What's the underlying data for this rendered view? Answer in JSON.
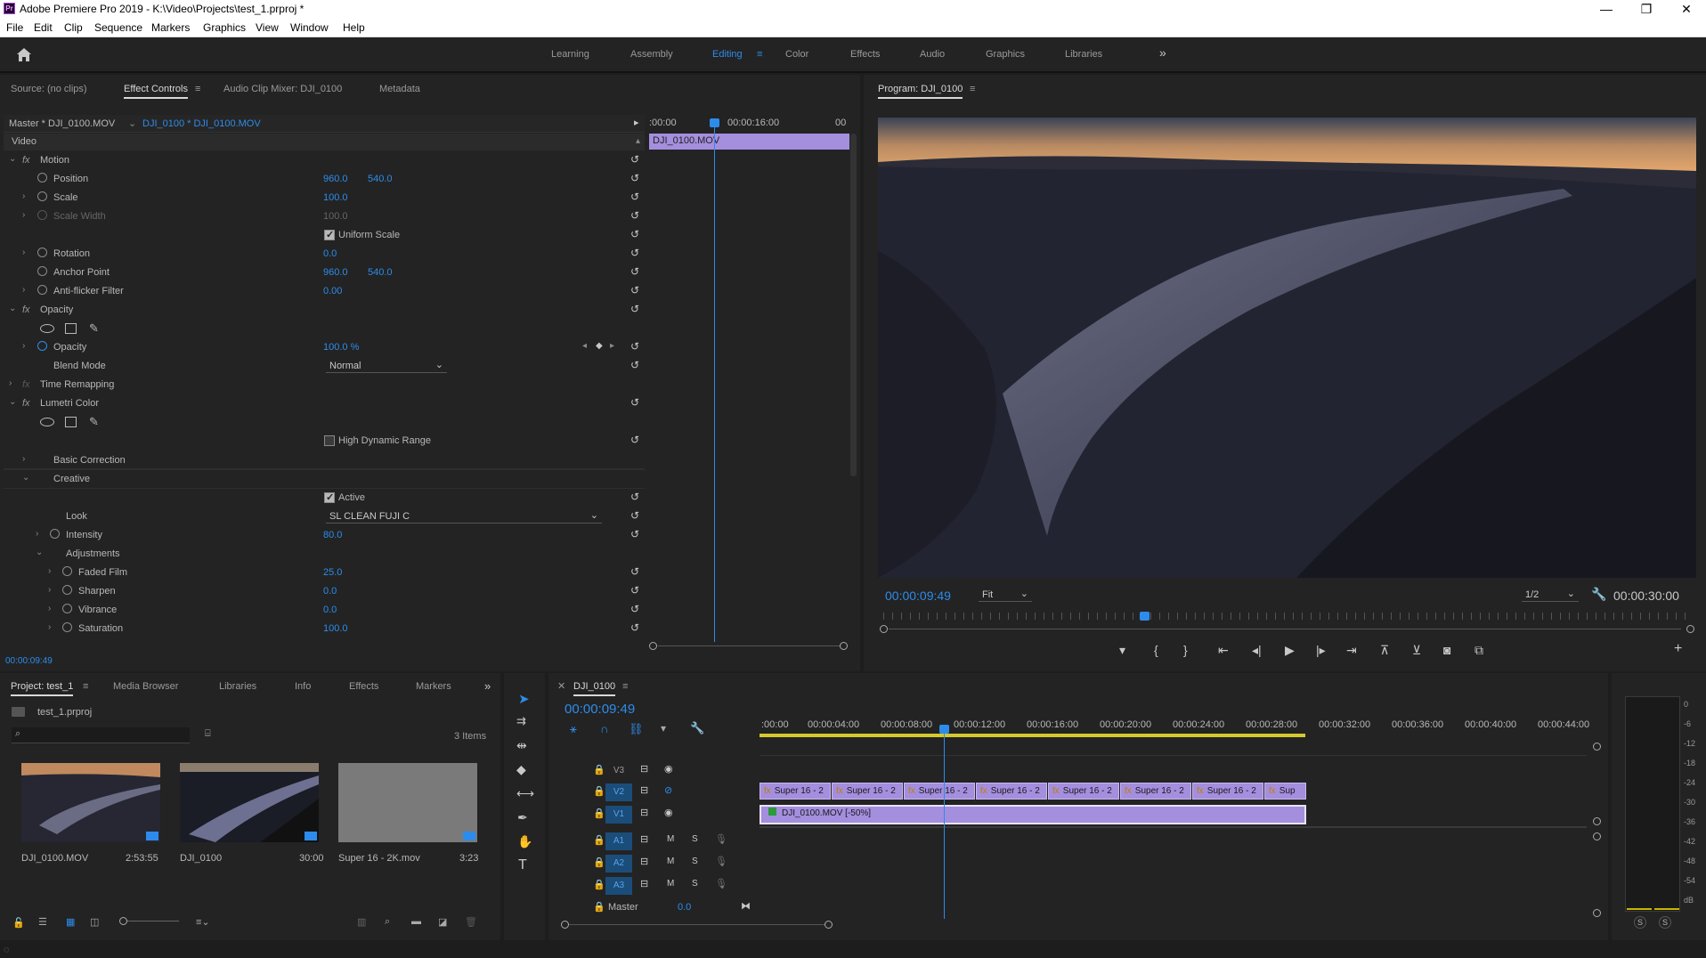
{
  "app": {
    "title": "Adobe Premiere Pro 2019 - K:\\Video\\Projects\\test_1.prproj *",
    "logo": "Pr"
  },
  "window_buttons": [
    "—",
    "❐",
    "✕"
  ],
  "menu": [
    "File",
    "Edit",
    "Clip",
    "Sequence",
    "Markers",
    "Graphics",
    "View",
    "Window",
    "Help"
  ],
  "workspaces": {
    "items": [
      "Learning",
      "Assembly",
      "Editing",
      "Color",
      "Effects",
      "Audio",
      "Graphics",
      "Libraries"
    ],
    "active": "Editing",
    "more": "»"
  },
  "source_panel": {
    "tabs": [
      "Source: (no clips)",
      "Effect Controls",
      "Audio Clip Mixer: DJI_0100",
      "Metadata"
    ],
    "master_label": "Master * DJI_0100.MOV",
    "clip_label": "DJI_0100 * DJI_0100.MOV",
    "timeline_start": ":00:00",
    "timeline_mid": "00:00:16:00",
    "timeline_end": "00",
    "clip_bar": "DJI_0100.MOV",
    "section": "Video",
    "timecode": "00:00:09:49",
    "rows": {
      "motion": "Motion",
      "position": "Position",
      "pos_x": "960.0",
      "pos_y": "540.0",
      "scale": "Scale",
      "scale_v": "100.0",
      "scale_width": "Scale Width",
      "scale_width_v": "100.0",
      "uniform_scale": "Uniform Scale",
      "rotation": "Rotation",
      "rotation_v": "0.0",
      "anchor": "Anchor Point",
      "anchor_x": "960.0",
      "anchor_y": "540.0",
      "antiflicker": "Anti-flicker Filter",
      "antiflicker_v": "0.00",
      "opacity_group": "Opacity",
      "opacity": "Opacity",
      "opacity_v": "100.0 %",
      "blend_mode": "Blend Mode",
      "blend_v": "Normal",
      "time_remap": "Time Remapping",
      "lumetri": "Lumetri Color",
      "hdr": "High Dynamic Range",
      "basic_correction": "Basic Correction",
      "creative": "Creative",
      "active": "Active",
      "look": "Look",
      "look_v": "SL CLEAN FUJI C",
      "intensity": "Intensity",
      "intensity_v": "80.0",
      "adjustments": "Adjustments",
      "faded_film": "Faded Film",
      "faded_film_v": "25.0",
      "sharpen": "Sharpen",
      "sharpen_v": "0.0",
      "vibrance": "Vibrance",
      "vibrance_v": "0.0",
      "saturation": "Saturation",
      "saturation_v": "100.0"
    }
  },
  "program": {
    "title": "Program: DJI_0100",
    "timecode": "00:00:09:49",
    "fit": "Fit",
    "resolution": "1/2",
    "duration": "00:00:30:00"
  },
  "project": {
    "tabs": [
      "Project: test_1",
      "Media Browser",
      "Libraries",
      "Info",
      "Effects",
      "Markers"
    ],
    "file": "test_1.prproj",
    "items_count": "3 Items",
    "items": [
      {
        "name": "DJI_0100.MOV",
        "duration": "2:53:55"
      },
      {
        "name": "DJI_0100",
        "duration": "30:00"
      },
      {
        "name": "Super 16 - 2K.mov",
        "duration": "3:23"
      }
    ]
  },
  "timeline": {
    "name": "DJI_0100",
    "timecode": "00:00:09:49",
    "ticks": [
      ":00:00",
      "00:00:04:00",
      "00:00:08:00",
      "00:00:12:00",
      "00:00:16:00",
      "00:00:20:00",
      "00:00:24:00",
      "00:00:28:00",
      "00:00:32:00",
      "00:00:36:00",
      "00:00:40:00",
      "00:00:44:00"
    ],
    "tracks": {
      "v3": "V3",
      "v2": "V2",
      "v1": "V1",
      "a1": "A1",
      "a2": "A2",
      "a3": "A3",
      "master": "Master",
      "master_v": "0.0",
      "m": "M",
      "s": "S"
    },
    "v2_clips": [
      "Super 16 - 2",
      "Super 16 - 2",
      "Super 16 - 2",
      "Super 16 - 2",
      "Super 16 - 2",
      "Super 16 - 2",
      "Super 16 - 2",
      "Sup"
    ],
    "v1_clip": "DJI_0100.MOV [-50%]"
  },
  "meter": {
    "scale": [
      "0",
      "-6",
      "-12",
      "-18",
      "-24",
      "-30",
      "-36",
      "-42",
      "-48",
      "-54",
      "dB"
    ],
    "solo": [
      "S",
      "S"
    ]
  },
  "colors": {
    "accent": "#2d8ceb",
    "clip": "#a48ede",
    "track_badge": "#1b4d7a"
  }
}
